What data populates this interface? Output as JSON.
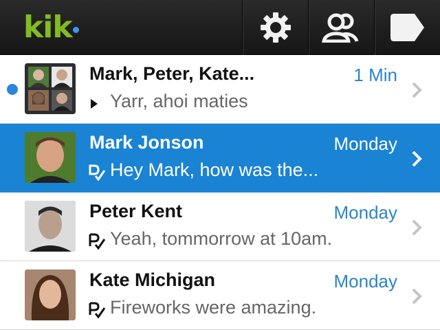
{
  "app": {
    "logo": "kik",
    "colors": {
      "brand_green": "#82bc23",
      "accent_blue": "#1a83d4",
      "time_blue": "#2b85c9"
    }
  },
  "toolbar": {
    "buttons": [
      {
        "name": "settings",
        "icon": "gear-icon"
      },
      {
        "name": "people",
        "icon": "people-icon"
      },
      {
        "name": "compose",
        "icon": "compose-icon"
      }
    ]
  },
  "conversations": [
    {
      "name": "Mark, Peter, Kate...",
      "time": "1 Min",
      "message": "Yarr, ahoi maties",
      "status_icon": "play-icon",
      "unread": true,
      "selected": false,
      "avatar": "group-avatar"
    },
    {
      "name": "Mark Jonson",
      "time": "Monday",
      "message": "Hey Mark, how was the...",
      "status_icon": "delivered-icon",
      "unread": false,
      "selected": true,
      "avatar": "avatar-mark"
    },
    {
      "name": "Peter Kent",
      "time": "Monday",
      "message": "Yeah, tommorrow at 10am.",
      "status_icon": "read-icon",
      "unread": false,
      "selected": false,
      "avatar": "avatar-peter"
    },
    {
      "name": "Kate Michigan",
      "time": "Monday",
      "message": "Fireworks were amazing.",
      "status_icon": "read-icon",
      "unread": false,
      "selected": false,
      "avatar": "avatar-kate"
    }
  ]
}
